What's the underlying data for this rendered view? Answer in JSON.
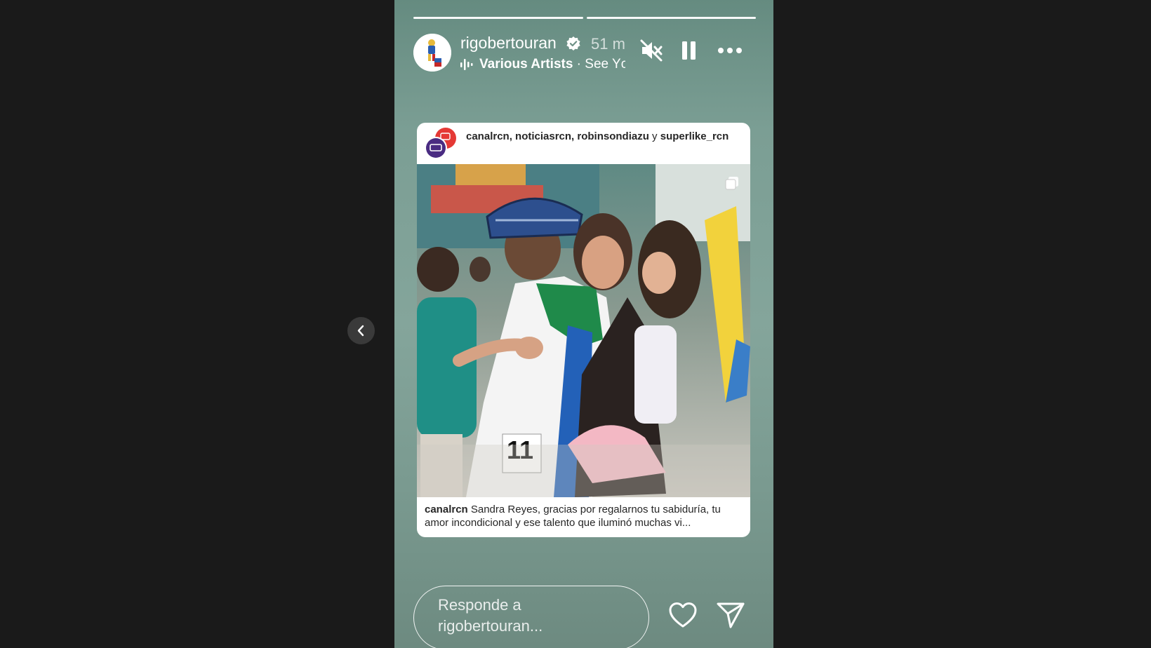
{
  "header": {
    "username": "rigobertouran",
    "time": "51 m",
    "music_artist": "Various Artists",
    "music_separator": " · ",
    "music_title": "See Yc"
  },
  "card": {
    "authors_bold": "canalrcn, noticiasrcn, robinsondiazu",
    "authors_join": " y ",
    "authors_last": "superlike_rcn",
    "caption_user": "canalrcn",
    "caption_text": " Sandra Reyes, gracias por regalarnos tu sabiduría, tu amor incondicional y ese talento que iluminó muchas vi..."
  },
  "reply": {
    "placeholder": "Responde a rigobertouran..."
  },
  "progress": {
    "segments": 2,
    "active": 2
  },
  "icons": [
    "verified-badge-icon",
    "music-bars-icon",
    "muted-speaker-icon",
    "pause-icon",
    "more-icon",
    "multi-photo-icon",
    "heart-icon",
    "send-icon",
    "chevron-left-icon"
  ],
  "colors": {
    "page_bg": "#1a1a1a",
    "story_bg": "#7b9e94",
    "white": "#ffffff",
    "nav_button": "#3a3a3a"
  }
}
